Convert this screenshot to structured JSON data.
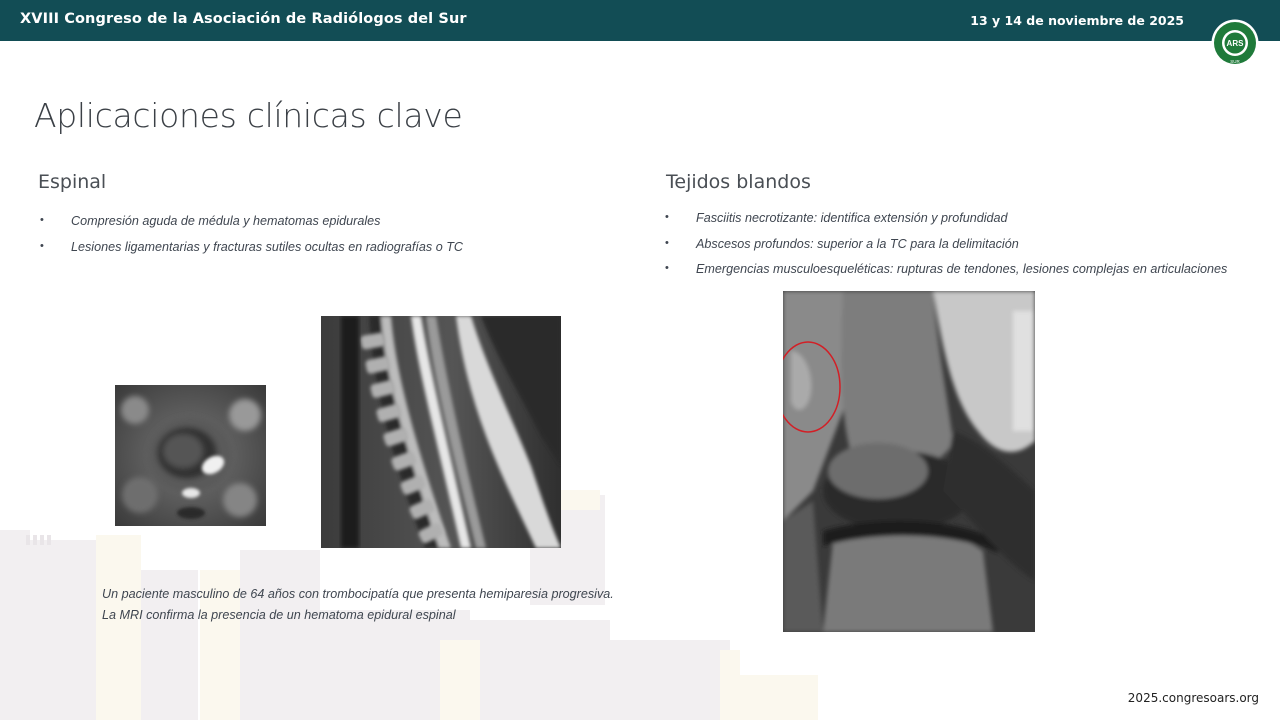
{
  "header": {
    "title": "XVIII Congreso de la Asociación de Radiólogos del Sur",
    "date": "13 y 14 de noviembre de 2025",
    "logo": {
      "center_text": "ARS",
      "ring_top": "ASOCIACIÓN RADIÓLOGOS",
      "ring_bottom": "SUR",
      "color": "#1f7a3a"
    }
  },
  "slide": {
    "title": "Aplicaciones clínicas clave",
    "left": {
      "heading": "Espinal",
      "bullets": [
        "Compresión aguda de médula y hematomas epidurales",
        "Lesiones ligamentarias y fracturas sutiles ocultas en radiografías o TC"
      ],
      "caption_lines": [
        "Un paciente masculino de 64 años con trombocipatía que presenta hemiparesia progresiva.",
        "La MRI confirma la presencia de un hematoma epidural espinal"
      ]
    },
    "right": {
      "heading": "Tejidos blandos",
      "bullets": [
        "Fasciitis necrotizante: identifica extensión y profundidad",
        "Abscesos profundos: superior a la TC para la delimitación",
        "Emergencias musculoesqueléticas: rupturas de tendones, lesiones complejas en articulaciones"
      ]
    },
    "bullet_glyph": "•"
  },
  "footer": {
    "url": "2025.congresoars.org"
  },
  "colors": {
    "header_bg": "#124d55",
    "annotation_circle": "#d21f26"
  }
}
